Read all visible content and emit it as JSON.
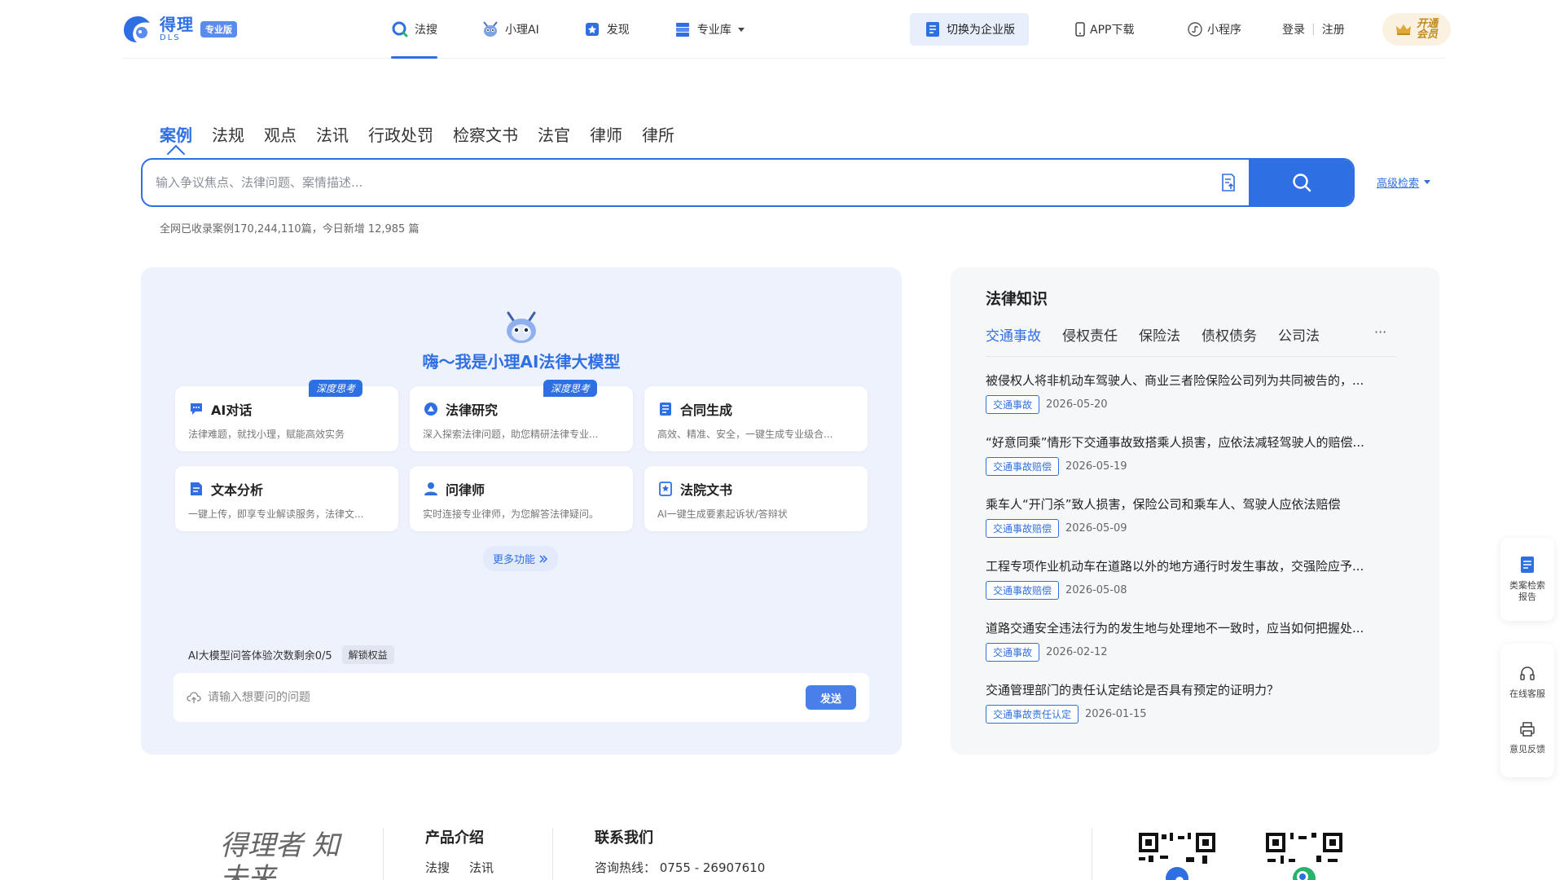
{
  "header": {
    "logo_text": "得理",
    "logo_en": "DLS",
    "logo_badge": "专业版",
    "nav": [
      {
        "label": "法搜",
        "active": true
      },
      {
        "label": "小理AI"
      },
      {
        "label": "发现"
      },
      {
        "label": "专业库"
      }
    ],
    "switch_label": "切换为企业版",
    "app_download": "APP下载",
    "mini_program": "小程序",
    "login": "登录",
    "register": "注册",
    "vip_line1": "开通",
    "vip_line2": "会员"
  },
  "search": {
    "tabs": [
      "案例",
      "法规",
      "观点",
      "法讯",
      "行政处罚",
      "检察文书",
      "法官",
      "律师",
      "律所"
    ],
    "placeholder": "输入争议焦点、法律问题、案情描述...",
    "advanced": "高级检索",
    "stats": "全网已收录案例170,244,110篇，今日新增 12,985 篇"
  },
  "ai": {
    "title": "嗨～我是小理AI法律大模型",
    "features": [
      {
        "title": "AI对话",
        "desc": "法律难题，就找小理，赋能高效实务",
        "badge": "深度思考"
      },
      {
        "title": "法律研究",
        "desc": "深入探索法律问题，助您精研法律专业...",
        "badge": "深度思考"
      },
      {
        "title": "合同生成",
        "desc": "高效、精准、安全，一键生成专业级合..."
      },
      {
        "title": "文本分析",
        "desc": "一键上传，即享专业解读服务，法律文..."
      },
      {
        "title": "问律师",
        "desc": "实时连接专业律师，为您解答法律疑问。"
      },
      {
        "title": "法院文书",
        "desc": "AI一键生成要素起诉状/答辩状"
      }
    ],
    "more": "更多功能",
    "quota": "AI大模型问答体验次数剩余0/5",
    "unlock": "解锁权益",
    "ask_placeholder": "请输入想要问的问题",
    "send": "发送"
  },
  "knowledge": {
    "title": "法律知识",
    "tabs": [
      "交通事故",
      "侵权责任",
      "保险法",
      "债权债务",
      "公司法"
    ],
    "more": "···",
    "items": [
      {
        "title": "被侵权人将非机动车驾驶人、商业三者险保险公司列为共同被告的，...",
        "tag": "交通事故",
        "date": "2026-05-20"
      },
      {
        "title": "“好意同乘”情形下交通事故致搭乘人损害，应依法减轻驾驶人的赔偿...",
        "tag": "交通事故赔偿",
        "date": "2026-05-19"
      },
      {
        "title": "乘车人“开门杀”致人损害，保险公司和乘车人、驾驶人应依法赔偿",
        "tag": "交通事故赔偿",
        "date": "2026-05-09"
      },
      {
        "title": "工程专项作业机动车在道路以外的地方通行时发生事故，交强险应予...",
        "tag": "交通事故赔偿",
        "date": "2026-05-08"
      },
      {
        "title": "道路交通安全违法行为的发生地与处理地不一致时，应当如何把握处...",
        "tag": "交通事故",
        "date": "2026-02-12"
      },
      {
        "title": "交通管理部门的责任认定结论是否具有预定的证明力？",
        "tag": "交通事故责任认定",
        "date": "2026-01-15"
      }
    ]
  },
  "float": {
    "report": "类案检索报告",
    "service": "在线客服",
    "feedback": "意见反馈"
  },
  "footer": {
    "logo": "得理者 知未来",
    "products_title": "产品介绍",
    "products": [
      "法搜",
      "法讯"
    ],
    "contact_title": "联系我们",
    "hotline": "咨询热线： 0755 - 26907610"
  },
  "colors": {
    "brand": "#2f6fe4",
    "ai_bg": "#eef2fc",
    "knowledge_bg": "#f6f7f9"
  }
}
